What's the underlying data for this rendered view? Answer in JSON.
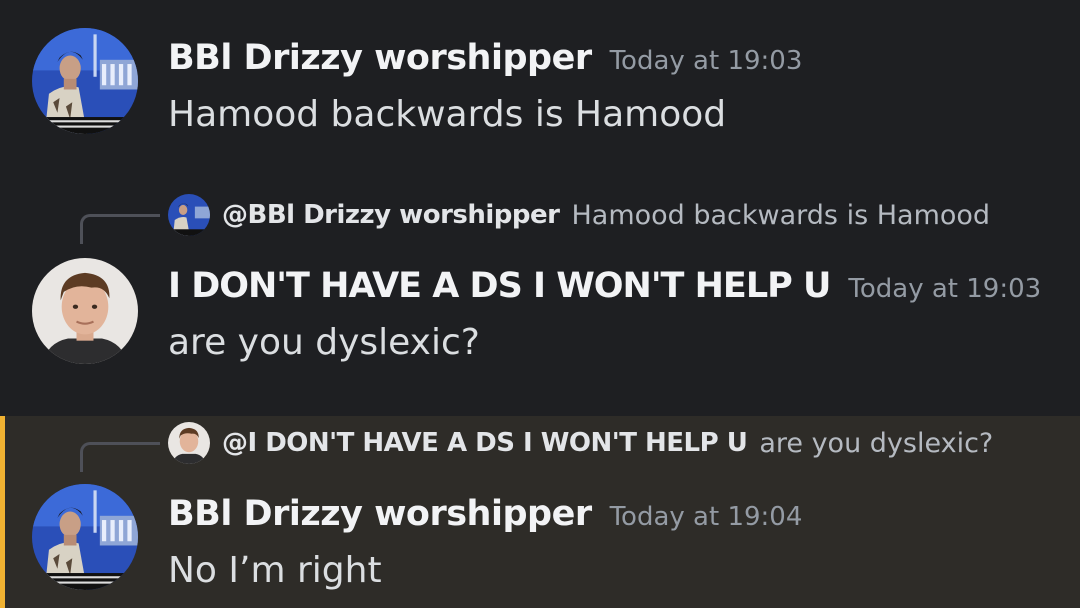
{
  "messages": [
    {
      "author": "BBl Drizzy worshipper",
      "timestamp": "Today at 19:03",
      "content": "Hamood backwards is Hamood",
      "avatar": "anime-character-avatar"
    },
    {
      "reply_to": {
        "mention": "@BBl Drizzy worshipper",
        "text": "Hamood backwards is Hamood",
        "avatar": "anime-character-avatar"
      },
      "author": "I DON'T HAVE A DS I WON'T HELP U",
      "timestamp": "Today at 19:03",
      "content": "are you dyslexic?",
      "avatar": "person-photo-avatar"
    },
    {
      "reply_to": {
        "mention": "@I DON'T HAVE A DS I WON'T HELP U",
        "text": "are you dyslexic?",
        "avatar": "person-photo-avatar"
      },
      "author": "BBl Drizzy worshipper",
      "timestamp": "Today at 19:04",
      "content": "No I’m right",
      "avatar": "anime-character-avatar",
      "highlighted": true
    }
  ],
  "colors": {
    "background": "#1e1f22",
    "highlight_background": "#2e2c28",
    "highlight_bar": "#f0b232",
    "author": "#f2f3f5",
    "content": "#dbdee1",
    "timestamp": "#949ba4"
  }
}
